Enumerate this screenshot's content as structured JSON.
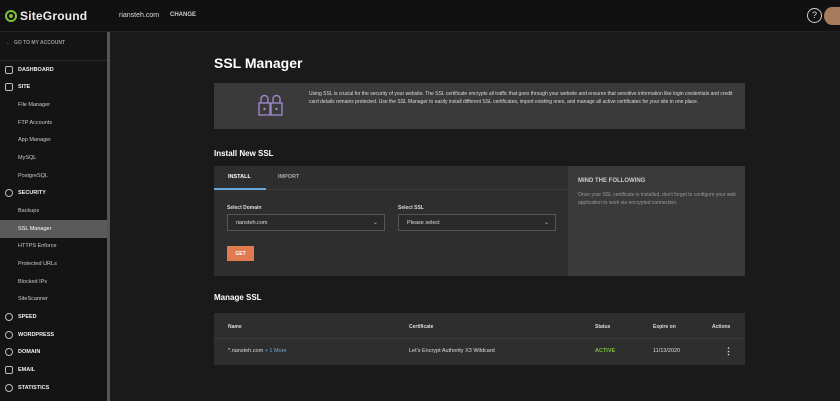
{
  "topbar": {
    "logo": "SiteGround",
    "site_name": "riansteh.com",
    "change_label": "CHANGE",
    "help_icon": "?"
  },
  "sidebar": {
    "back_label": "GO TO MY ACCOUNT",
    "items": [
      {
        "label": "DASHBOARD",
        "type": "head"
      },
      {
        "label": "SITE",
        "type": "head"
      },
      {
        "label": "File Manager",
        "type": "sub"
      },
      {
        "label": "FTP Accounts",
        "type": "sub"
      },
      {
        "label": "App Manager",
        "type": "sub"
      },
      {
        "label": "MySQL",
        "type": "sub"
      },
      {
        "label": "PostgreSQL",
        "type": "sub"
      },
      {
        "label": "SECURITY",
        "type": "head"
      },
      {
        "label": "Backups",
        "type": "sub"
      },
      {
        "label": "SSL Manager",
        "type": "sub",
        "active": true
      },
      {
        "label": "HTTPS Enforce",
        "type": "sub"
      },
      {
        "label": "Protected URLs",
        "type": "sub"
      },
      {
        "label": "Blocked IPs",
        "type": "sub"
      },
      {
        "label": "SiteScanner",
        "type": "sub"
      },
      {
        "label": "SPEED",
        "type": "head"
      },
      {
        "label": "WORDPRESS",
        "type": "head"
      },
      {
        "label": "DOMAIN",
        "type": "head"
      },
      {
        "label": "EMAIL",
        "type": "head"
      },
      {
        "label": "STATISTICS",
        "type": "head"
      }
    ]
  },
  "main": {
    "title": "SSL Manager",
    "info_text": "Using SSL is crucial for the security of your website. The SSL certificate encrypts all traffic that goes through your website and ensures that sensitive information like login credentials and credit card details remains protected. Use the SSL Manager to easily install different SSL certificates, import existing ones, and manage all active certificates for your site in one place.",
    "install": {
      "section_title": "Install New SSL",
      "tabs": [
        "INSTALL",
        "IMPORT"
      ],
      "domain_label": "Select Domain",
      "domain_value": "riansteh.com",
      "ssl_label": "Select SSL",
      "ssl_value": "Please select",
      "get_label": "GET",
      "mind_title": "MIND THE FOLLOWING",
      "mind_text": "Once your SSL certificate is installed, don't forget to configure your web application to work via encrypted connection."
    },
    "manage": {
      "section_title": "Manage SSL",
      "columns": [
        "Name",
        "Certificate",
        "Status",
        "Expire on",
        "Actions"
      ],
      "row": {
        "name": "*.riansteh.com",
        "more": "+ 1 More",
        "certificate": "Let's Encrypt Authority X3 Wildcard",
        "status": "ACTIVE",
        "expire": "11/13/2020",
        "actions": "⋮"
      }
    }
  }
}
